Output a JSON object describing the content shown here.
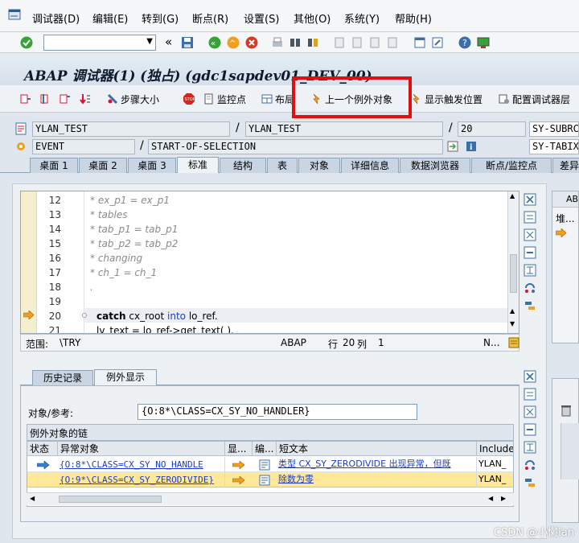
{
  "menu": {
    "items": [
      "调试器(D)",
      "编辑(E)",
      "转到(G)",
      "断点(R)",
      "设置(S)",
      "其他(O)",
      "系统(Y)",
      "帮助(H)"
    ]
  },
  "toolbar": {
    "command_value": ""
  },
  "title": "ABAP 调试器(1)  (独占) (gdc1sapdev01_DEV_00)",
  "app_toolbar": {
    "step_size": "步骤大小",
    "watchpoint": "监控点",
    "layout": "布局",
    "prev_exception": "上一个例外对象",
    "show_trigger": "显示触发位置",
    "config_layer": "配置调试器层"
  },
  "fields": {
    "row1": {
      "program": "YLAN_TEST",
      "include": "YLAN_TEST",
      "line": "20",
      "sysfield": "SY-SUBRC"
    },
    "row2": {
      "event_type": "EVENT",
      "event_name": "START-OF-SELECTION",
      "sysfield": "SY-TABIX"
    }
  },
  "tabs": [
    "桌面 1",
    "桌面 2",
    "桌面 3",
    "标准",
    "结构",
    "表",
    "对象",
    "详细信息",
    "数据浏览器",
    "断点/监控点",
    "差异"
  ],
  "active_tab": "标准",
  "code_lines": [
    {
      "num": "12",
      "text": "*    ex_p1  = ex_p1"
    },
    {
      "num": "13",
      "text": "*  tables"
    },
    {
      "num": "14",
      "text": "*    tab_p1 = tab_p1"
    },
    {
      "num": "15",
      "text": "*    tab_p2 = tab_p2"
    },
    {
      "num": "16",
      "text": "*  changing"
    },
    {
      "num": "17",
      "text": "*    ch_1   = ch_1"
    },
    {
      "num": "18",
      "text": "     ."
    },
    {
      "num": "19",
      "text": ""
    },
    {
      "num": "20",
      "kw": "catch",
      "rest1": " cx_root ",
      "kw2": "into",
      "rest2": " lo_ref."
    },
    {
      "num": "21",
      "text": "  lv_text = lo_ref->get_text( )."
    }
  ],
  "status": {
    "scope_label": "范围:",
    "scope_value": "\\TRY",
    "abap": "ABAP",
    "row_label": "行",
    "row_value": "20",
    "col_label": "列",
    "col_value": "1",
    "mode": "N..."
  },
  "right_panel": {
    "header": "AB",
    "row_label": "堆..."
  },
  "lower": {
    "tabs": [
      "历史记录",
      "例外显示"
    ],
    "active_tab": "例外显示",
    "obj_label": "对象/参考:",
    "obj_value": "{O:8*\\CLASS=CX_SY_NO_HANDLER}",
    "chain_label": "例外对象的链",
    "columns": [
      "状态",
      "异常对象",
      "显...",
      "编...",
      "短文本",
      "Include"
    ],
    "rows": [
      {
        "obj": "{O:8*\\CLASS=CX_SY_NO_HANDLE",
        "text": "类型 CX_SY_ZERODIVIDE 出现异常，但既",
        "include": "YLAN_"
      },
      {
        "obj": "{O:9*\\CLASS=CX_SY_ZERODIVIDE}",
        "text": "除数为零",
        "include": "YLAN_"
      }
    ]
  },
  "watermark": "CSDN @小懒lan",
  "colors": {
    "redbox": "#e01010",
    "link": "#1a3cc8",
    "highlight_row": "#ffe89a"
  }
}
